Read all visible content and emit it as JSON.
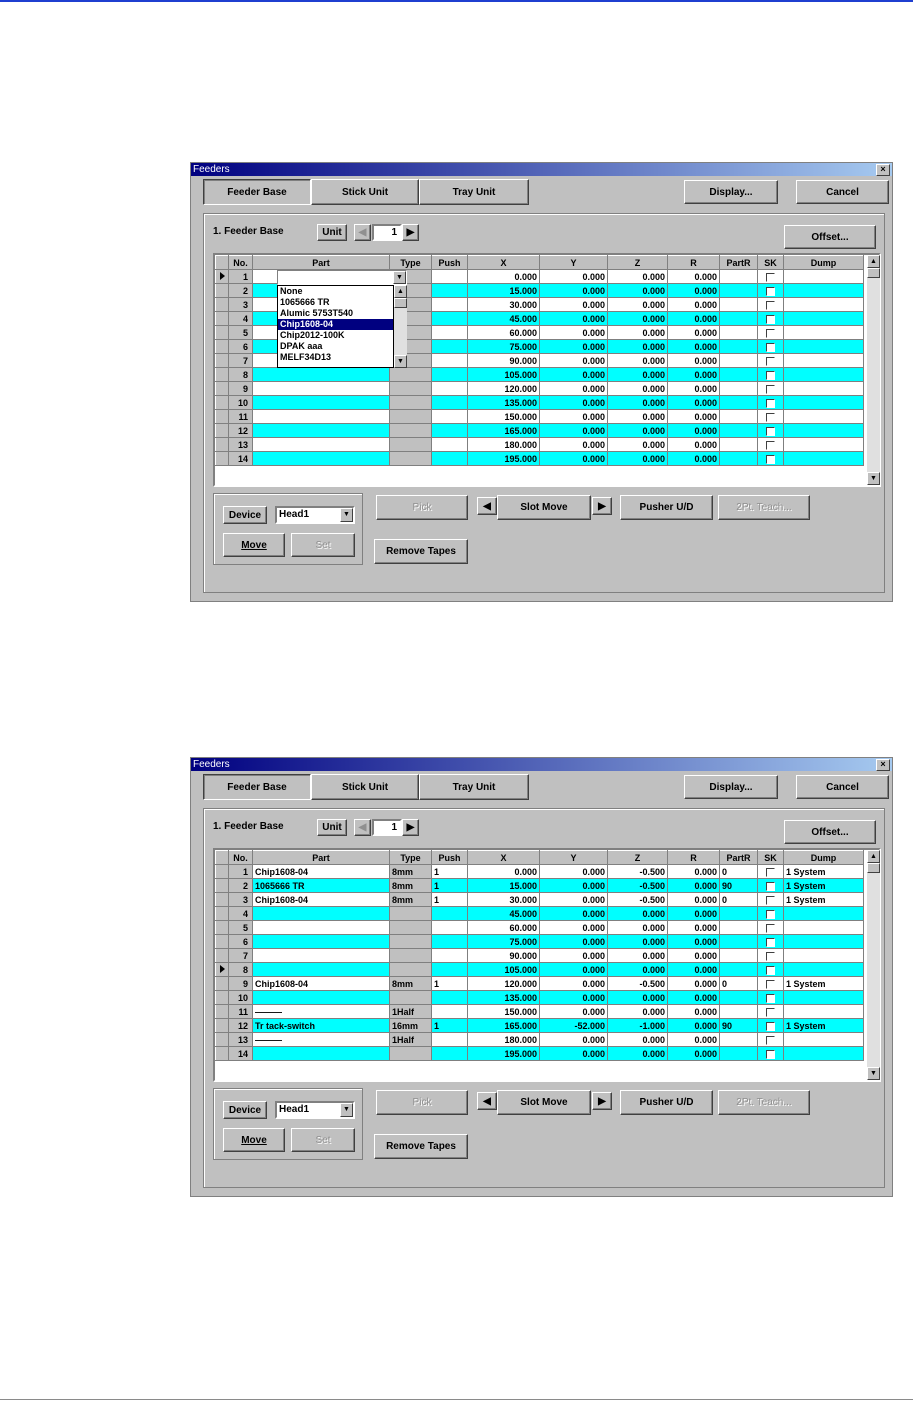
{
  "windows": [
    {
      "title": "Feeders",
      "tabs": [
        "Feeder Base",
        "Stick Unit",
        "Tray Unit"
      ],
      "display_button": "Display...",
      "cancel_button": "Cancel",
      "section_label": "1. Feeder Base",
      "unit_label": "Unit",
      "unit_value": "1",
      "offset_button": "Offset...",
      "columns": [
        "No.",
        "Part",
        "Type",
        "Push",
        "X",
        "Y",
        "Z",
        "R",
        "PartR",
        "SK",
        "Dump"
      ],
      "current_row": 1,
      "rows": [
        {
          "no": "1",
          "part": "",
          "type": "",
          "push": "",
          "x": "0.000",
          "y": "0.000",
          "z": "0.000",
          "r": "0.000",
          "partr": "",
          "dump": "",
          "cyan": false
        },
        {
          "no": "2",
          "part": "",
          "type": "",
          "push": "",
          "x": "15.000",
          "y": "0.000",
          "z": "0.000",
          "r": "0.000",
          "partr": "",
          "dump": "",
          "cyan": true
        },
        {
          "no": "3",
          "part": "",
          "type": "",
          "push": "",
          "x": "30.000",
          "y": "0.000",
          "z": "0.000",
          "r": "0.000",
          "partr": "",
          "dump": "",
          "cyan": false
        },
        {
          "no": "4",
          "part": "",
          "type": "",
          "push": "",
          "x": "45.000",
          "y": "0.000",
          "z": "0.000",
          "r": "0.000",
          "partr": "",
          "dump": "",
          "cyan": true
        },
        {
          "no": "5",
          "part": "",
          "type": "",
          "push": "",
          "x": "60.000",
          "y": "0.000",
          "z": "0.000",
          "r": "0.000",
          "partr": "",
          "dump": "",
          "cyan": false
        },
        {
          "no": "6",
          "part": "",
          "type": "",
          "push": "",
          "x": "75.000",
          "y": "0.000",
          "z": "0.000",
          "r": "0.000",
          "partr": "",
          "dump": "",
          "cyan": true
        },
        {
          "no": "7",
          "part": "",
          "type": "",
          "push": "",
          "x": "90.000",
          "y": "0.000",
          "z": "0.000",
          "r": "0.000",
          "partr": "",
          "dump": "",
          "cyan": false
        },
        {
          "no": "8",
          "part": "",
          "type": "",
          "push": "",
          "x": "105.000",
          "y": "0.000",
          "z": "0.000",
          "r": "0.000",
          "partr": "",
          "dump": "",
          "cyan": true
        },
        {
          "no": "9",
          "part": "",
          "type": "",
          "push": "",
          "x": "120.000",
          "y": "0.000",
          "z": "0.000",
          "r": "0.000",
          "partr": "",
          "dump": "",
          "cyan": false
        },
        {
          "no": "10",
          "part": "",
          "type": "",
          "push": "",
          "x": "135.000",
          "y": "0.000",
          "z": "0.000",
          "r": "0.000",
          "partr": "",
          "dump": "",
          "cyan": true
        },
        {
          "no": "11",
          "part": "",
          "type": "",
          "push": "",
          "x": "150.000",
          "y": "0.000",
          "z": "0.000",
          "r": "0.000",
          "partr": "",
          "dump": "",
          "cyan": false
        },
        {
          "no": "12",
          "part": "",
          "type": "",
          "push": "",
          "x": "165.000",
          "y": "0.000",
          "z": "0.000",
          "r": "0.000",
          "partr": "",
          "dump": "",
          "cyan": true
        },
        {
          "no": "13",
          "part": "",
          "type": "",
          "push": "",
          "x": "180.000",
          "y": "0.000",
          "z": "0.000",
          "r": "0.000",
          "partr": "",
          "dump": "",
          "cyan": false
        },
        {
          "no": "14",
          "part": "",
          "type": "",
          "push": "",
          "x": "195.000",
          "y": "0.000",
          "z": "0.000",
          "r": "0.000",
          "partr": "",
          "dump": "",
          "cyan": true
        }
      ],
      "part_dropdown_open": true,
      "part_options": [
        "None",
        "1065666 TR",
        "Alumic 5753T540",
        "Chip1608-04",
        "Chip2012-100K",
        "DPAK aaa",
        "MELF34D13"
      ],
      "part_option_highlight": 3,
      "device_label": "Device",
      "device_value": "Head1",
      "move_button": "Move",
      "set_button": "Set",
      "pick_button": "Pick",
      "slot_move_button": "Slot Move",
      "pusher_button": "Pusher U/D",
      "teach_button": "2Pt. Teach...",
      "remove_tapes_button": "Remove Tapes"
    },
    {
      "title": "Feeders",
      "tabs": [
        "Feeder Base",
        "Stick Unit",
        "Tray Unit"
      ],
      "display_button": "Display...",
      "cancel_button": "Cancel",
      "section_label": "1. Feeder Base",
      "unit_label": "Unit",
      "unit_value": "1",
      "offset_button": "Offset...",
      "columns": [
        "No.",
        "Part",
        "Type",
        "Push",
        "X",
        "Y",
        "Z",
        "R",
        "PartR",
        "SK",
        "Dump"
      ],
      "current_row": 8,
      "rows": [
        {
          "no": "1",
          "part": "Chip1608-04",
          "type": "8mm",
          "push": "1",
          "x": "0.000",
          "y": "0.000",
          "z": "-0.500",
          "r": "0.000",
          "partr": "0",
          "dump": "1 System",
          "cyan": false
        },
        {
          "no": "2",
          "part": "1065666 TR",
          "type": "8mm",
          "push": "1",
          "x": "15.000",
          "y": "0.000",
          "z": "-0.500",
          "r": "0.000",
          "partr": "90",
          "dump": "1 System",
          "cyan": true
        },
        {
          "no": "3",
          "part": "Chip1608-04",
          "type": "8mm",
          "push": "1",
          "x": "30.000",
          "y": "0.000",
          "z": "-0.500",
          "r": "0.000",
          "partr": "0",
          "dump": "1 System",
          "cyan": false
        },
        {
          "no": "4",
          "part": "",
          "type": "",
          "push": "",
          "x": "45.000",
          "y": "0.000",
          "z": "0.000",
          "r": "0.000",
          "partr": "",
          "dump": "",
          "cyan": true
        },
        {
          "no": "5",
          "part": "",
          "type": "",
          "push": "",
          "x": "60.000",
          "y": "0.000",
          "z": "0.000",
          "r": "0.000",
          "partr": "",
          "dump": "",
          "cyan": false
        },
        {
          "no": "6",
          "part": "",
          "type": "",
          "push": "",
          "x": "75.000",
          "y": "0.000",
          "z": "0.000",
          "r": "0.000",
          "partr": "",
          "dump": "",
          "cyan": true
        },
        {
          "no": "7",
          "part": "",
          "type": "",
          "push": "",
          "x": "90.000",
          "y": "0.000",
          "z": "0.000",
          "r": "0.000",
          "partr": "",
          "dump": "",
          "cyan": false
        },
        {
          "no": "8",
          "part": "",
          "type": "",
          "push": "",
          "x": "105.000",
          "y": "0.000",
          "z": "0.000",
          "r": "0.000",
          "partr": "",
          "dump": "",
          "cyan": true
        },
        {
          "no": "9",
          "part": "Chip1608-04",
          "type": "8mm",
          "push": "1",
          "x": "120.000",
          "y": "0.000",
          "z": "-0.500",
          "r": "0.000",
          "partr": "0",
          "dump": "1 System",
          "cyan": false
        },
        {
          "no": "10",
          "part": "",
          "type": "",
          "push": "",
          "x": "135.000",
          "y": "0.000",
          "z": "0.000",
          "r": "0.000",
          "partr": "",
          "dump": "",
          "cyan": true
        },
        {
          "no": "11",
          "part": "———",
          "type": "1Half",
          "push": "",
          "x": "150.000",
          "y": "0.000",
          "z": "0.000",
          "r": "0.000",
          "partr": "",
          "dump": "",
          "cyan": false
        },
        {
          "no": "12",
          "part": "Tr tack-switch",
          "type": "16mm",
          "push": "1",
          "x": "165.000",
          "y": "-52.000",
          "z": "-1.000",
          "r": "0.000",
          "partr": "90",
          "dump": "1 System",
          "cyan": true
        },
        {
          "no": "13",
          "part": "———",
          "type": "1Half",
          "push": "",
          "x": "180.000",
          "y": "0.000",
          "z": "0.000",
          "r": "0.000",
          "partr": "",
          "dump": "",
          "cyan": false
        },
        {
          "no": "14",
          "part": "",
          "type": "",
          "push": "",
          "x": "195.000",
          "y": "0.000",
          "z": "0.000",
          "r": "0.000",
          "partr": "",
          "dump": "",
          "cyan": true
        }
      ],
      "part_dropdown_open": false,
      "part_options": [],
      "part_option_highlight": -1,
      "device_label": "Device",
      "device_value": "Head1",
      "move_button": "Move",
      "set_button": "Set",
      "pick_button": "Pick",
      "slot_move_button": "Slot Move",
      "pusher_button": "Pusher U/D",
      "teach_button": "2Pt. Teach...",
      "remove_tapes_button": "Remove Tapes"
    }
  ]
}
